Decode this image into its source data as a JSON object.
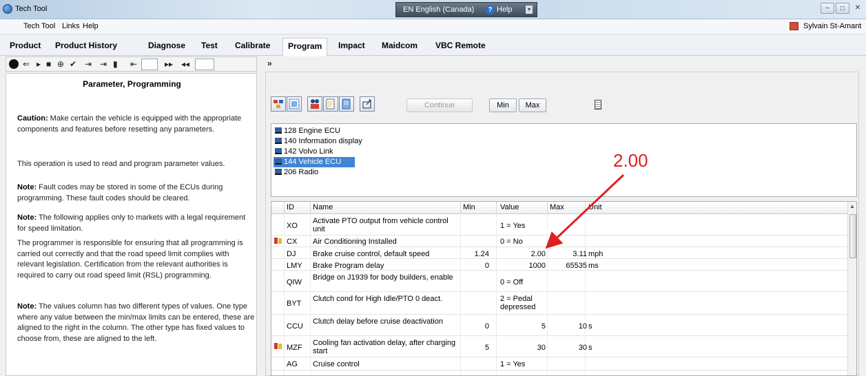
{
  "window": {
    "title": "Tech Tool",
    "language": "EN English (Canada)",
    "help": "Help",
    "help_icon": "?",
    "help_caret": "▾",
    "minimize": "−",
    "maximize": "□",
    "close": "✕"
  },
  "menu": {
    "items": [
      "Tech Tool",
      "Links",
      "Help"
    ],
    "user": "Sylvain St-Amant"
  },
  "tabs": [
    "Product",
    "Product History",
    "Diagnose",
    "Test",
    "Calibrate",
    "Program",
    "Impact",
    "Maidcom",
    "VBC Remote"
  ],
  "active_tab": "Program",
  "left_toolbar": {
    "expand": "»"
  },
  "left_panel": {
    "title": "Parameter, Programming",
    "p1_label": "Caution:",
    "p1_text": " Make certain the vehicle is equipped with the appropriate components and features before resetting any parameters.",
    "p2_text": "This operation is used to read and program parameter values.",
    "p3_label": "Note:",
    "p3_text": " Fault codes may be stored in some of the ECUs during programming. These fault codes should be cleared.",
    "p4_label": "Note:",
    "p4_text": " The following applies only to markets with a legal requirement for speed limitation.",
    "p4b_text": "The programmer is responsible for ensuring that all programming is carried out correctly and that the road speed limit complies with relevant legislation. Certification from the relevant authorities is required to carry out road speed limit (RSL) programming.",
    "p5_label": "Note:",
    "p5_text": " The values column has two different types of values. One type where any value between the min/max limits can be entered, these are aligned to the right in the column. The other type has fixed values to choose from, these are aligned to the left."
  },
  "toolbar": {
    "continue": "Continue",
    "min": "Min",
    "max": "Max"
  },
  "ecus": [
    {
      "label": "128  Engine ECU"
    },
    {
      "label": "140  Information display"
    },
    {
      "label": "142  Volvo Link"
    },
    {
      "label": "144  Vehicle ECU"
    },
    {
      "label": "206  Radio"
    }
  ],
  "selected_ecu": "144  Vehicle ECU",
  "annotation": "2.00",
  "table": {
    "headers": {
      "id": "ID",
      "name": "Name",
      "min": "Min",
      "value": "Value",
      "max": "Max",
      "unit": "Unit"
    },
    "rows": [
      {
        "id": "XO",
        "name": "Activate PTO output from vehicle control unit",
        "min": "",
        "value": "1 = Yes",
        "max": "",
        "unit": ""
      },
      {
        "id": "CX",
        "name": "Air Conditioning Installed",
        "min": "",
        "value": "0 = No",
        "max": "",
        "unit": ""
      },
      {
        "id": "DJ",
        "name": "Brake cruise control, default speed",
        "min": "1.24",
        "value": "2.00",
        "max": "3.11",
        "unit": "mph"
      },
      {
        "id": "LMY",
        "name": "Brake Program delay",
        "min": "0",
        "value": "1000",
        "max": "65535",
        "unit": "ms"
      },
      {
        "id": "QIW",
        "name": "Bridge on J1939 for body builders, enable",
        "min": "",
        "value": "0 = Off",
        "max": "",
        "unit": ""
      },
      {
        "id": "BYT",
        "name": "Clutch cond for High Idle/PTO 0 deact.",
        "min": "",
        "value": "2 = Pedal depressed",
        "max": "",
        "unit": ""
      },
      {
        "id": "CCU",
        "name": "Clutch delay before cruise deactivation",
        "min": "0",
        "value": "5",
        "max": "10",
        "unit": "s"
      },
      {
        "id": "MZF",
        "name": "Cooling fan activation delay, after charging start",
        "min": "5",
        "value": "30",
        "max": "30",
        "unit": "s"
      },
      {
        "id": "AG",
        "name": "Cruise control",
        "min": "",
        "value": "1 = Yes",
        "max": "",
        "unit": ""
      }
    ]
  },
  "colors": {
    "annotation": "#e02020",
    "selection": "#3f86d4"
  }
}
